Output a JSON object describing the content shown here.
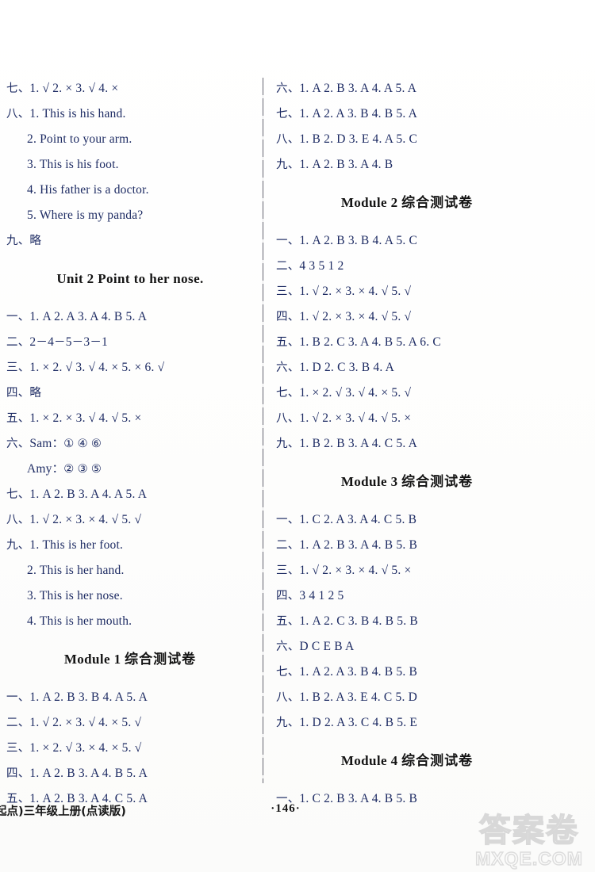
{
  "page": {
    "number": "·146·",
    "footer_book": "起点)三年级上册(点读版)"
  },
  "watermark": {
    "cn": "答案卷",
    "url": "MXQE.COM"
  },
  "left_column": {
    "blocks": [
      {
        "type": "answers",
        "lines": [
          {
            "text": "七、1. √   2. ×   3. √   4. ×"
          },
          {
            "text": "八、1. This is his hand."
          },
          {
            "text": "2. Point to your arm.",
            "indent": 1
          },
          {
            "text": "3. This is his foot.",
            "indent": 1
          },
          {
            "text": "4. His father is a doctor.",
            "indent": 1
          },
          {
            "text": "5. Where is my panda?",
            "indent": 1
          },
          {
            "text": "九、略"
          }
        ]
      },
      {
        "type": "heading",
        "text": "Unit 2   Point to her nose."
      },
      {
        "type": "answers",
        "lines": [
          {
            "text": "一、1. A   2. A   3. A   4. B   5. A"
          },
          {
            "text": "二、2－4－5－3－1"
          },
          {
            "text": "三、1. ×   2. √   3. √   4. ×   5. ×   6. √"
          },
          {
            "text": "四、略"
          },
          {
            "text": "五、1. ×   2. ×   3. √   4. √   5. ×"
          },
          {
            "text": "六、Sam：①  ④  ⑥"
          },
          {
            "text": "Amy：②  ③  ⑤",
            "indent": 1
          },
          {
            "text": "七、1. A   2. B   3. A   4. A   5. A"
          },
          {
            "text": "八、1. √   2. ×   3. ×   4. √   5. √"
          },
          {
            "text": "九、1. This is her foot."
          },
          {
            "text": "2. This is her hand.",
            "indent": 1
          },
          {
            "text": "3. This is her nose.",
            "indent": 1
          },
          {
            "text": "4. This is her mouth.",
            "indent": 1
          }
        ]
      },
      {
        "type": "heading",
        "text": "Module 1 综合测试卷"
      },
      {
        "type": "answers",
        "lines": [
          {
            "text": "一、1. A   2. B   3. B   4. A   5. A"
          },
          {
            "text": "二、1. √   2. ×   3. √   4. ×   5. √"
          },
          {
            "text": "三、1. ×   2. √   3. ×   4. ×   5. √"
          },
          {
            "text": "四、1. A   2. B   3. A   4. B   5. A"
          },
          {
            "text": "五、1. A   2. B   3. A   4. C   5. A"
          }
        ]
      }
    ]
  },
  "right_column": {
    "blocks": [
      {
        "type": "answers",
        "lines": [
          {
            "text": "六、1. A   2. B   3. A   4. A   5. A"
          },
          {
            "text": "七、1. A   2. A   3. B   4. B   5. A"
          },
          {
            "text": "八、1. B   2. D   3. E   4. A   5. C"
          },
          {
            "text": "九、1. A   2. B   3. A   4. B"
          }
        ]
      },
      {
        "type": "heading",
        "text": "Module 2 综合测试卷"
      },
      {
        "type": "answers",
        "lines": [
          {
            "text": "一、1. A   2. B   3. B   4. A   5. C"
          },
          {
            "text": "二、4  3  5  1  2"
          },
          {
            "text": "三、1. √   2. ×   3. ×   4. √   5. √"
          },
          {
            "text": "四、1. √   2. ×   3. ×   4. √   5. √"
          },
          {
            "text": "五、1. B   2. C   3. A   4. B   5. A   6. C"
          },
          {
            "text": "六、1. D   2. C   3. B   4. A"
          },
          {
            "text": "七、1. ×   2. √   3. √   4. ×   5. √"
          },
          {
            "text": "八、1. √   2. ×   3. √   4. √   5. ×"
          },
          {
            "text": "九、1. B   2. B   3. A   4. C   5. A"
          }
        ]
      },
      {
        "type": "heading",
        "text": "Module 3 综合测试卷"
      },
      {
        "type": "answers",
        "lines": [
          {
            "text": "一、1. C   2. A   3. A   4. C   5. B"
          },
          {
            "text": "二、1. A   2. B   3. A   4. B   5. B"
          },
          {
            "text": "三、1. √   2. ×   3. ×   4. √   5. ×"
          },
          {
            "text": "四、3  4  1  2  5"
          },
          {
            "text": "五、1. A   2. C   3. B   4. B   5. B"
          },
          {
            "text": "六、D  C  E  B  A"
          },
          {
            "text": "七、1. A   2. A   3. B   4. B   5. B"
          },
          {
            "text": "八、1. B   2. A   3. E   4. C   5. D"
          },
          {
            "text": "九、1. D   2. A   3. C   4. B   5. E"
          }
        ]
      },
      {
        "type": "heading",
        "text": "Module 4 综合测试卷"
      },
      {
        "type": "answers",
        "lines": [
          {
            "text": "一、1. C   2. B   3. A   4. B   5. B"
          }
        ]
      }
    ]
  }
}
